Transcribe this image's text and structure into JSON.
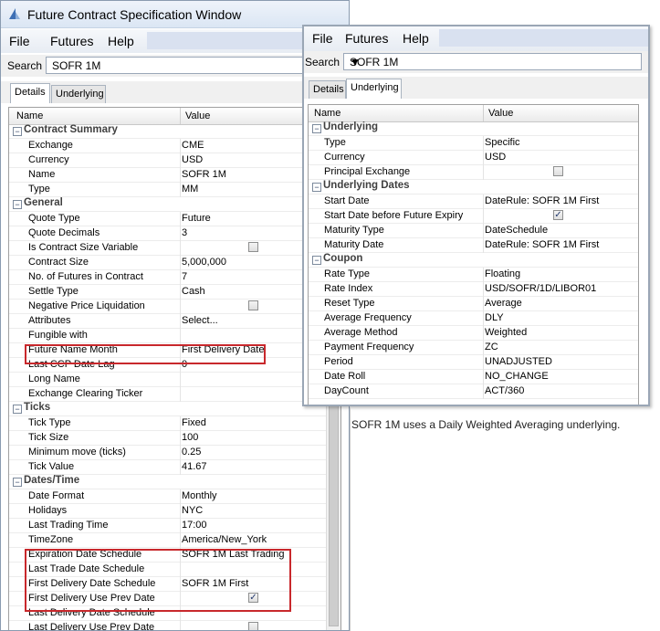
{
  "window1": {
    "title": "Future Contract Specification Window",
    "menu": [
      "File",
      "Futures",
      "Help"
    ],
    "search_label": "Search",
    "search_value": "SOFR 1M",
    "tabs": [
      "Details",
      "Underlying"
    ],
    "active_tab": "Details",
    "columns": [
      "Name",
      "Value"
    ],
    "rows": [
      {
        "type": "cat",
        "name": "Contract Summary"
      },
      {
        "type": "prop",
        "name": "Exchange",
        "value": "CME"
      },
      {
        "type": "prop",
        "name": "Currency",
        "value": "USD"
      },
      {
        "type": "prop",
        "name": "Name",
        "value": "SOFR 1M"
      },
      {
        "type": "prop",
        "name": "Type",
        "value": "MM"
      },
      {
        "type": "cat",
        "name": "General"
      },
      {
        "type": "prop",
        "name": "Quote Type",
        "value": "Future"
      },
      {
        "type": "prop",
        "name": "Quote Decimals",
        "value": "3"
      },
      {
        "type": "prop",
        "name": "Is Contract Size Variable",
        "checkbox": true,
        "checked": false
      },
      {
        "type": "prop",
        "name": "Contract Size",
        "value": "5,000,000"
      },
      {
        "type": "prop",
        "name": "No. of Futures in Contract",
        "value": "7"
      },
      {
        "type": "prop",
        "name": "Settle Type",
        "value": "Cash"
      },
      {
        "type": "prop",
        "name": "Negative Price Liquidation",
        "checkbox": true,
        "checked": false
      },
      {
        "type": "prop",
        "name": "Attributes",
        "value": "Select..."
      },
      {
        "type": "prop",
        "name": "Fungible with",
        "value": ""
      },
      {
        "type": "prop",
        "name": "Future Name Month",
        "value": "First Delivery Date"
      },
      {
        "type": "prop",
        "name": "Last CCP Date Lag",
        "value": "0"
      },
      {
        "type": "prop",
        "name": "Long Name",
        "value": ""
      },
      {
        "type": "prop",
        "name": "Exchange Clearing Ticker",
        "value": ""
      },
      {
        "type": "cat",
        "name": "Ticks"
      },
      {
        "type": "prop",
        "name": "Tick Type",
        "value": "Fixed"
      },
      {
        "type": "prop",
        "name": "Tick Size",
        "value": "100"
      },
      {
        "type": "prop",
        "name": "Minimum move (ticks)",
        "value": "0.25"
      },
      {
        "type": "prop",
        "name": "Tick Value",
        "value": "41.67"
      },
      {
        "type": "cat",
        "name": "Dates/Time"
      },
      {
        "type": "prop",
        "name": "Date Format",
        "value": "Monthly"
      },
      {
        "type": "prop",
        "name": "Holidays",
        "value": "NYC"
      },
      {
        "type": "prop",
        "name": "Last Trading Time",
        "value": "17:00"
      },
      {
        "type": "prop",
        "name": "TimeZone",
        "value": "America/New_York"
      },
      {
        "type": "prop",
        "name": "Expiration Date Schedule",
        "value": "SOFR 1M Last Trading"
      },
      {
        "type": "prop",
        "name": "Last Trade Date Schedule",
        "value": ""
      },
      {
        "type": "prop",
        "name": "First Delivery Date Schedule",
        "value": "SOFR 1M First"
      },
      {
        "type": "prop",
        "name": "First Delivery Use Prev Date",
        "checkbox": true,
        "checked": true
      },
      {
        "type": "prop",
        "name": "Last Delivery Date Schedule",
        "value": ""
      },
      {
        "type": "prop",
        "name": "Last Delivery Use Prev Date",
        "checkbox": true,
        "checked": false
      }
    ]
  },
  "window2": {
    "menu": [
      "File",
      "Futures",
      "Help"
    ],
    "search_label": "Search",
    "search_value": "SOFR 1M",
    "tabs": [
      "Details",
      "Underlying"
    ],
    "active_tab": "Underlying",
    "columns": [
      "Name",
      "Value"
    ],
    "rows": [
      {
        "type": "cat",
        "name": "Underlying"
      },
      {
        "type": "prop",
        "name": "Type",
        "value": "Specific"
      },
      {
        "type": "prop",
        "name": "Currency",
        "value": "USD"
      },
      {
        "type": "prop",
        "name": "Principal Exchange",
        "checkbox": true,
        "checked": false
      },
      {
        "type": "cat",
        "name": "Underlying Dates"
      },
      {
        "type": "prop",
        "name": "Start Date",
        "value": "DateRule: SOFR 1M First"
      },
      {
        "type": "prop",
        "name": "Start Date before Future Expiry",
        "checkbox": true,
        "checked": true
      },
      {
        "type": "prop",
        "name": "Maturity Type",
        "value": "DateSchedule"
      },
      {
        "type": "prop",
        "name": "Maturity Date",
        "value": "DateRule: SOFR 1M First"
      },
      {
        "type": "cat",
        "name": "Coupon"
      },
      {
        "type": "prop",
        "name": "Rate Type",
        "value": "Floating"
      },
      {
        "type": "prop",
        "name": "Rate Index",
        "value": "USD/SOFR/1D/LIBOR01"
      },
      {
        "type": "prop",
        "name": "Reset Type",
        "value": "Average"
      },
      {
        "type": "prop",
        "name": "Average Frequency",
        "value": "DLY"
      },
      {
        "type": "prop",
        "name": "Average Method",
        "value": "Weighted"
      },
      {
        "type": "prop",
        "name": "Payment Frequency",
        "value": "ZC"
      },
      {
        "type": "prop",
        "name": "Period",
        "value": "UNADJUSTED"
      },
      {
        "type": "prop",
        "name": "Date Roll",
        "value": "NO_CHANGE"
      },
      {
        "type": "prop",
        "name": "DayCount",
        "value": "ACT/360"
      }
    ]
  },
  "note": "SOFR 1M uses a Daily Weighted Averaging underlying.",
  "colors": {
    "highlight_box": "#c8282c",
    "category_text": "#404040"
  }
}
